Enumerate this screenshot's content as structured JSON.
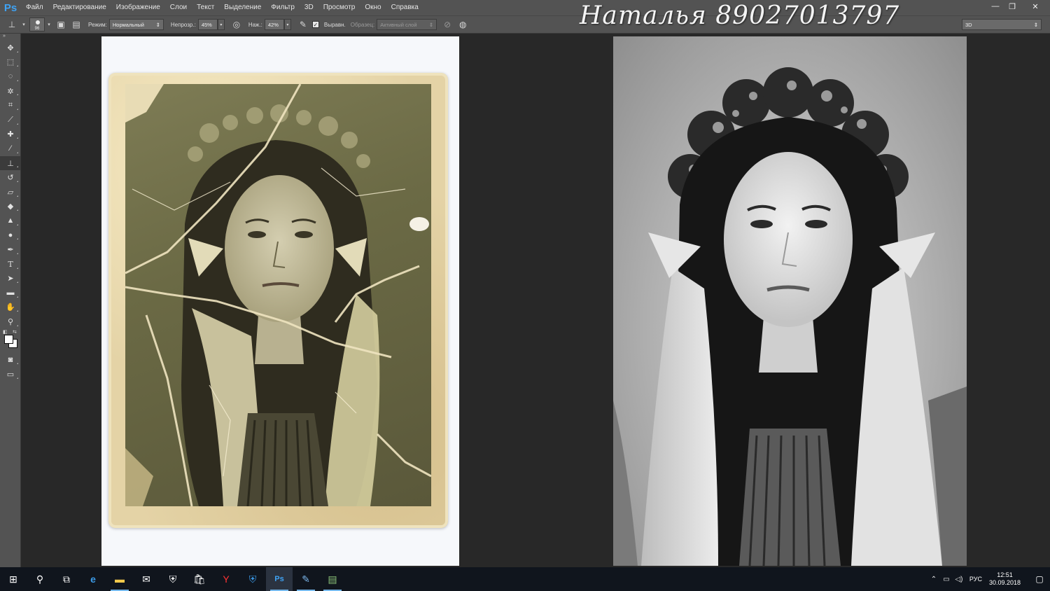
{
  "menu": {
    "logo": "Ps",
    "items": [
      "Файл",
      "Редактирование",
      "Изображение",
      "Слои",
      "Текст",
      "Выделение",
      "Фильтр",
      "3D",
      "Просмотр",
      "Окно",
      "Справка"
    ],
    "window_controls": {
      "minimize": "—",
      "restore": "❐",
      "close": "✕"
    }
  },
  "options": {
    "brush_size": "96",
    "mode_label": "Режим:",
    "mode_value": "Нормальный",
    "opacity_label": "Непрозр.:",
    "opacity_value": "45%",
    "flow_label": "Наж.:",
    "flow_value": "42%",
    "aligned_label": "Выравн.",
    "aligned_checked": true,
    "sample_label": "Образец:",
    "sample_value": "Активный слой",
    "workspace": "3D"
  },
  "signature": "Наталья 89027013797",
  "toolbox": {
    "tools": [
      "move-tool",
      "marquee-tool",
      "lasso-tool",
      "magic-wand-tool",
      "crop-tool",
      "eyedropper-tool",
      "healing-brush-tool",
      "brush-tool",
      "clone-stamp-tool",
      "history-brush-tool",
      "eraser-tool",
      "paint-bucket-tool",
      "blur-tool",
      "dodge-tool",
      "pen-tool",
      "type-tool",
      "path-selection-tool",
      "rectangle-tool",
      "hand-tool",
      "zoom-tool"
    ],
    "active_tool": "clone-stamp-tool",
    "foreground_color": "#ffffff",
    "background_color": "#ffffff"
  },
  "taskbar": {
    "apps": [
      "start",
      "search",
      "task-view",
      "edge",
      "file-explorer",
      "mail",
      "windows-defender",
      "store",
      "yandex-browser",
      "security-app",
      "photoshop",
      "app-editor",
      "app-files"
    ],
    "active_app": "photoshop",
    "language": "РУС",
    "time": "12:51",
    "date": "30.09.2018"
  },
  "colors": {
    "app_chrome": "#535353",
    "canvas_bg": "#282828",
    "taskbar": "#10151d",
    "ps_blue": "#3fa3f4"
  }
}
